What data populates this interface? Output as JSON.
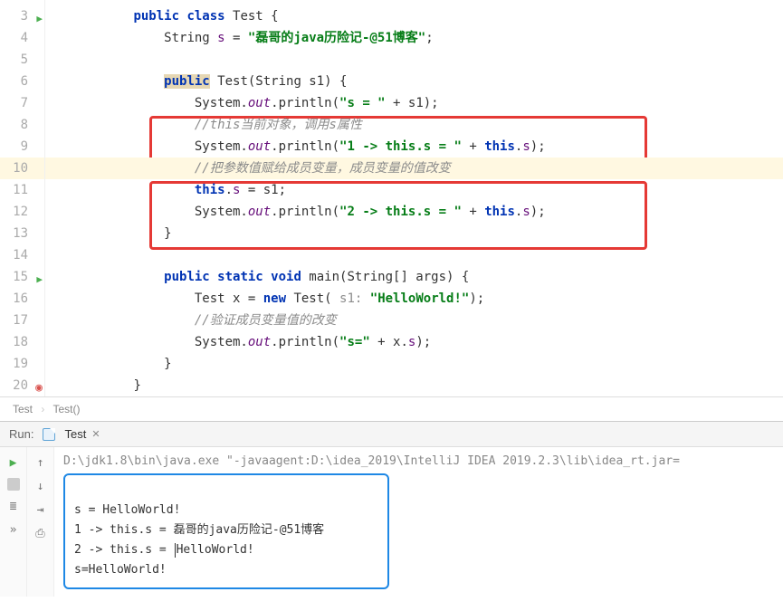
{
  "gutter": {
    "start": 3,
    "end": 20,
    "runLines": [
      3,
      15
    ],
    "eyeLines": [
      20
    ]
  },
  "code": {
    "l3": {
      "indent": "        ",
      "kw1": "public class",
      "rest": " Test {"
    },
    "l4": {
      "indent": "            ",
      "type": "String ",
      "field": "s",
      "eq": " = ",
      "str": "\"磊哥的java历险记-@51博客\"",
      "semi": ";"
    },
    "l5": {
      "text": ""
    },
    "l6": {
      "indent": "            ",
      "kw": "public",
      "rest": " Test(String s1) {"
    },
    "l7": {
      "indent": "                ",
      "pre": "System.",
      "out": "out",
      "mid": ".println(",
      "str": "\"s = \"",
      "post": " + s1);"
    },
    "l8": {
      "indent": "                ",
      "cmt": "//this当前对象，调用s属性"
    },
    "l9": {
      "indent": "                ",
      "pre": "System.",
      "out": "out",
      "mid": ".println(",
      "str": "\"1 -> this.s = \"",
      "plus": " + ",
      "kwthis": "this",
      "dot": ".",
      "field": "s",
      "end": ");"
    },
    "l10": {
      "indent": "                ",
      "cmt": "//把参数值赋给成员变量，成员变量的值改变"
    },
    "l11": {
      "indent": "                ",
      "kwthis": "this",
      "dot": ".",
      "field": "s",
      "rest": " = s1;"
    },
    "l12": {
      "indent": "                ",
      "pre": "System.",
      "out": "out",
      "mid": ".println(",
      "str": "\"2 -> this.s = \"",
      "plus": " + ",
      "kwthis": "this",
      "dot": ".",
      "field": "s",
      "end": ");"
    },
    "l13": {
      "indent": "            ",
      "brace": "}"
    },
    "l14": {
      "text": ""
    },
    "l15": {
      "indent": "            ",
      "kw": "public static void",
      "rest": " main(String[] args) {"
    },
    "l16": {
      "indent": "                ",
      "pre": "Test x = ",
      "kwnew": "new",
      "mid": " Test( ",
      "hint": "s1:",
      "sp": " ",
      "str": "\"HelloWorld!\"",
      "end": ");"
    },
    "l17": {
      "indent": "                ",
      "cmt": "//验证成员变量值的改变"
    },
    "l18": {
      "indent": "                ",
      "pre": "System.",
      "out": "out",
      "mid": ".println(",
      "str": "\"s=\"",
      "plus": " + x.",
      "field": "s",
      "end": ");"
    },
    "l19": {
      "indent": "            ",
      "brace": "}"
    },
    "l20": {
      "indent": "        ",
      "brace": "}"
    }
  },
  "breadcrumb": {
    "a": "Test",
    "b": "Test()"
  },
  "run": {
    "label": "Run:",
    "config": "Test",
    "cmd": "D:\\jdk1.8\\bin\\java.exe \"-javaagent:D:\\idea_2019\\IntelliJ IDEA 2019.2.3\\lib\\idea_rt.jar=",
    "out1": "s = HelloWorld!",
    "out2": "1 -> this.s = 磊哥的java历险记-@51博客",
    "out3a": "2 -> this.s = ",
    "out3b": "HelloWorld!",
    "out4": "s=HelloWorld!"
  }
}
